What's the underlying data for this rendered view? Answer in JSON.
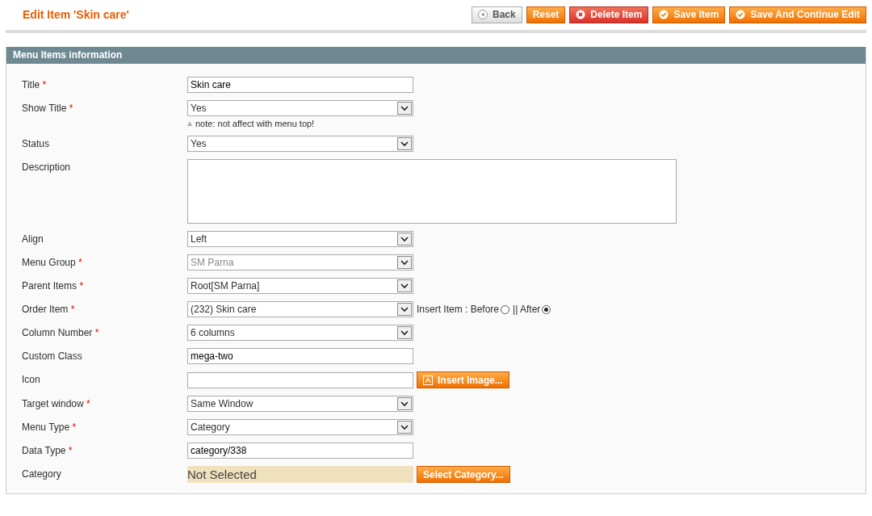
{
  "page_title": "Edit Item 'Skin care'",
  "buttons": [
    {
      "label": "Back",
      "kind": "back"
    },
    {
      "label": "Reset",
      "kind": "plain"
    },
    {
      "label": "Delete Item",
      "kind": "delete"
    },
    {
      "label": "Save Item",
      "kind": "save"
    },
    {
      "label": "Save And Continue Edit",
      "kind": "save"
    }
  ],
  "section_title": "Menu Items information",
  "fields": [
    {
      "label": "Title",
      "required_mark": "*",
      "kind": "text",
      "value": "Skin care"
    },
    {
      "label": "Show Title",
      "required_mark": "*",
      "kind": "select",
      "value": "Yes",
      "disabled": false,
      "note": "note: not affect with menu top!"
    },
    {
      "label": "Status",
      "kind": "select",
      "value": "Yes",
      "disabled": false
    },
    {
      "label": "Description",
      "kind": "textarea"
    },
    {
      "label": "Align",
      "kind": "select",
      "value": "Left",
      "disabled": false
    },
    {
      "label": "Menu Group",
      "required_mark": "*",
      "kind": "select",
      "value": "SM Parna",
      "disabled": true
    },
    {
      "label": "Parent Items",
      "required_mark": "*",
      "kind": "select",
      "value": "Root[SM Parna]",
      "disabled": false
    },
    {
      "label": "Order Item",
      "required_mark": "*",
      "kind": "select",
      "value": "(232) Skin care",
      "disabled": false,
      "position": {
        "label": "Insert Item : Before",
        "separator": "|| After",
        "before_selected": false,
        "after_selected": true
      }
    },
    {
      "label": "Column Number",
      "required_mark": "*",
      "kind": "select",
      "value": "6 columns",
      "disabled": false
    },
    {
      "label": "Custom Class",
      "kind": "text",
      "value": "mega-two"
    },
    {
      "label": "Icon",
      "kind": "image",
      "button": "Insert Image..."
    },
    {
      "label": "Target window",
      "required_mark": "*",
      "kind": "select",
      "value": "Same Window",
      "disabled": false
    },
    {
      "label": "Menu Type",
      "required_mark": "*",
      "kind": "select",
      "value": "Category",
      "disabled": false
    },
    {
      "label": "Data Type",
      "required_mark": "*",
      "kind": "text",
      "value": "category/338"
    },
    {
      "label": "Category",
      "kind": "category",
      "value": "Not Selected",
      "button": "Select Category..."
    }
  ]
}
